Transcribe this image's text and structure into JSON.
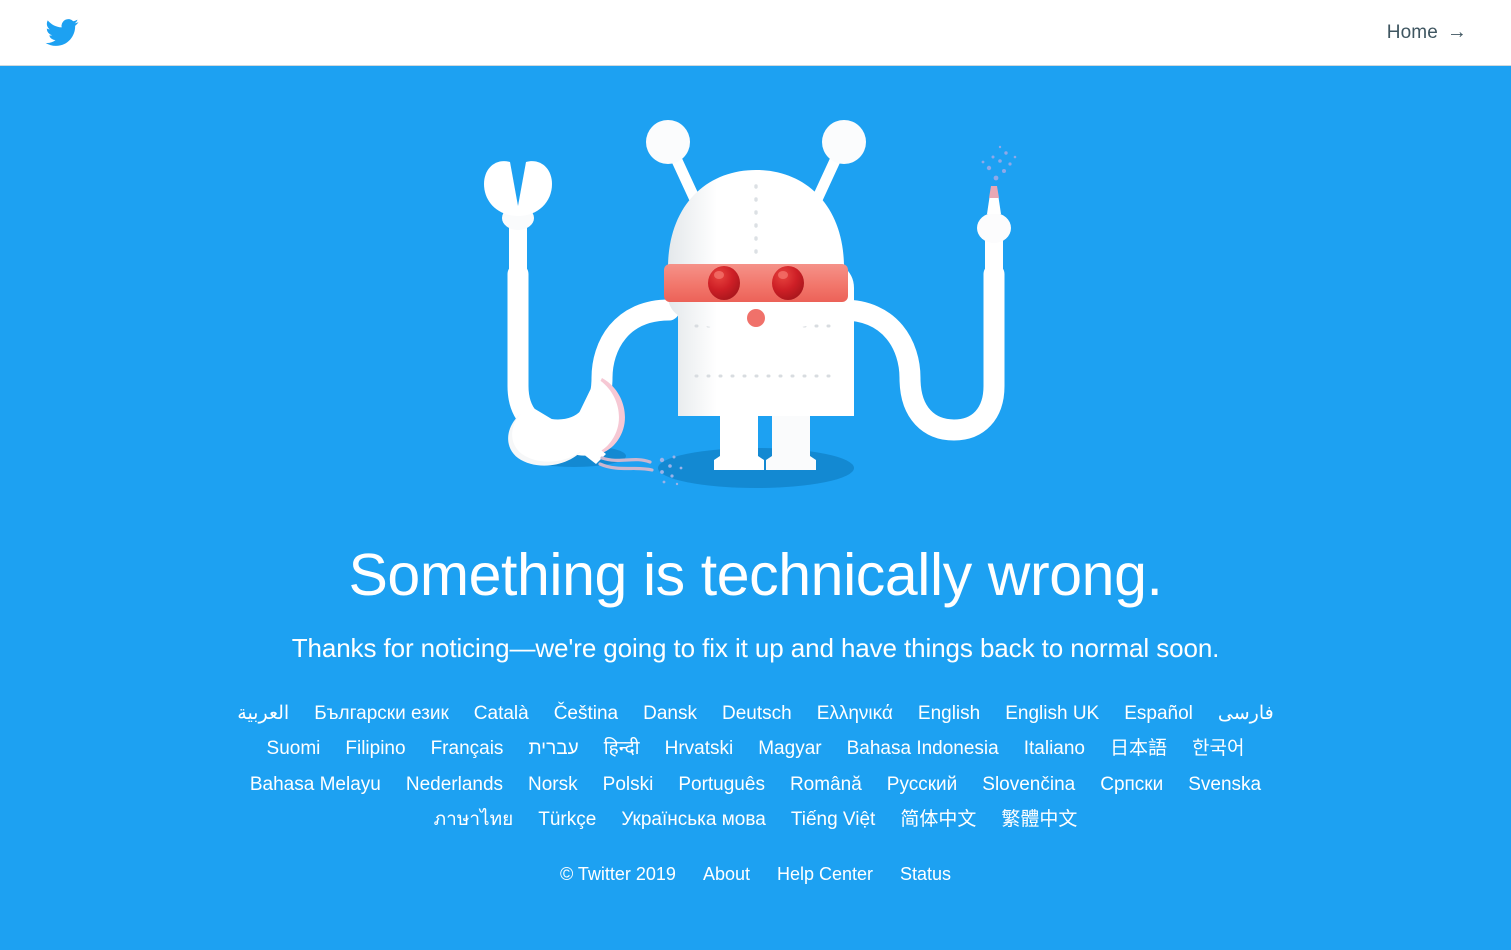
{
  "header": {
    "logo_name": "twitter-bird-logo",
    "home_label": "Home",
    "home_arrow": "→"
  },
  "colors": {
    "background_blue": "#1DA1F2",
    "header_white": "#FFFFFF",
    "header_text": "#3F5661",
    "robot_white": "#FFFFFF",
    "visor_red": "#F2776C",
    "eye_red": "#D8232A",
    "shadow_blue": "#1389D2",
    "seam_gray": "#D8DCE0",
    "shell_pink": "#F6C8D4"
  },
  "illustration": {
    "name": "broken-robot-illustration",
    "parts": [
      "antenna-left",
      "antenna-right",
      "robot-head",
      "red-visor",
      "eye-left",
      "eye-right",
      "nose-dot",
      "robot-torso",
      "arm-left-tentacle",
      "arm-right-tentacle",
      "claw-tool",
      "welding-torch",
      "sparks",
      "leg-left",
      "leg-right",
      "ground-shadow",
      "cracked-shell",
      "wires"
    ]
  },
  "message": {
    "headline": "Something is technically wrong.",
    "subhead": "Thanks for noticing—we're going to fix it up and have things back to normal soon."
  },
  "languages": {
    "rows": [
      [
        "العربية",
        "Български език",
        "Català",
        "Čeština",
        "Dansk",
        "Deutsch",
        "Ελληνικά",
        "English",
        "English UK",
        "Español",
        "فارسى"
      ],
      [
        "Suomi",
        "Filipino",
        "Français",
        "עברית",
        "हिन्दी",
        "Hrvatski",
        "Magyar",
        "Bahasa Indonesia",
        "Italiano",
        "日本語",
        "한국어"
      ],
      [
        "Bahasa Melayu",
        "Nederlands",
        "Norsk",
        "Polski",
        "Português",
        "Română",
        "Русский",
        "Slovenčina",
        "Српски",
        "Svenska"
      ],
      [
        "ภาษาไทย",
        "Türkçe",
        "Українська мова",
        "Tiếng Việt",
        "简体中文",
        "繁體中文"
      ]
    ]
  },
  "footer": {
    "copyright": "© Twitter 2019",
    "links": [
      "About",
      "Help Center",
      "Status"
    ]
  }
}
